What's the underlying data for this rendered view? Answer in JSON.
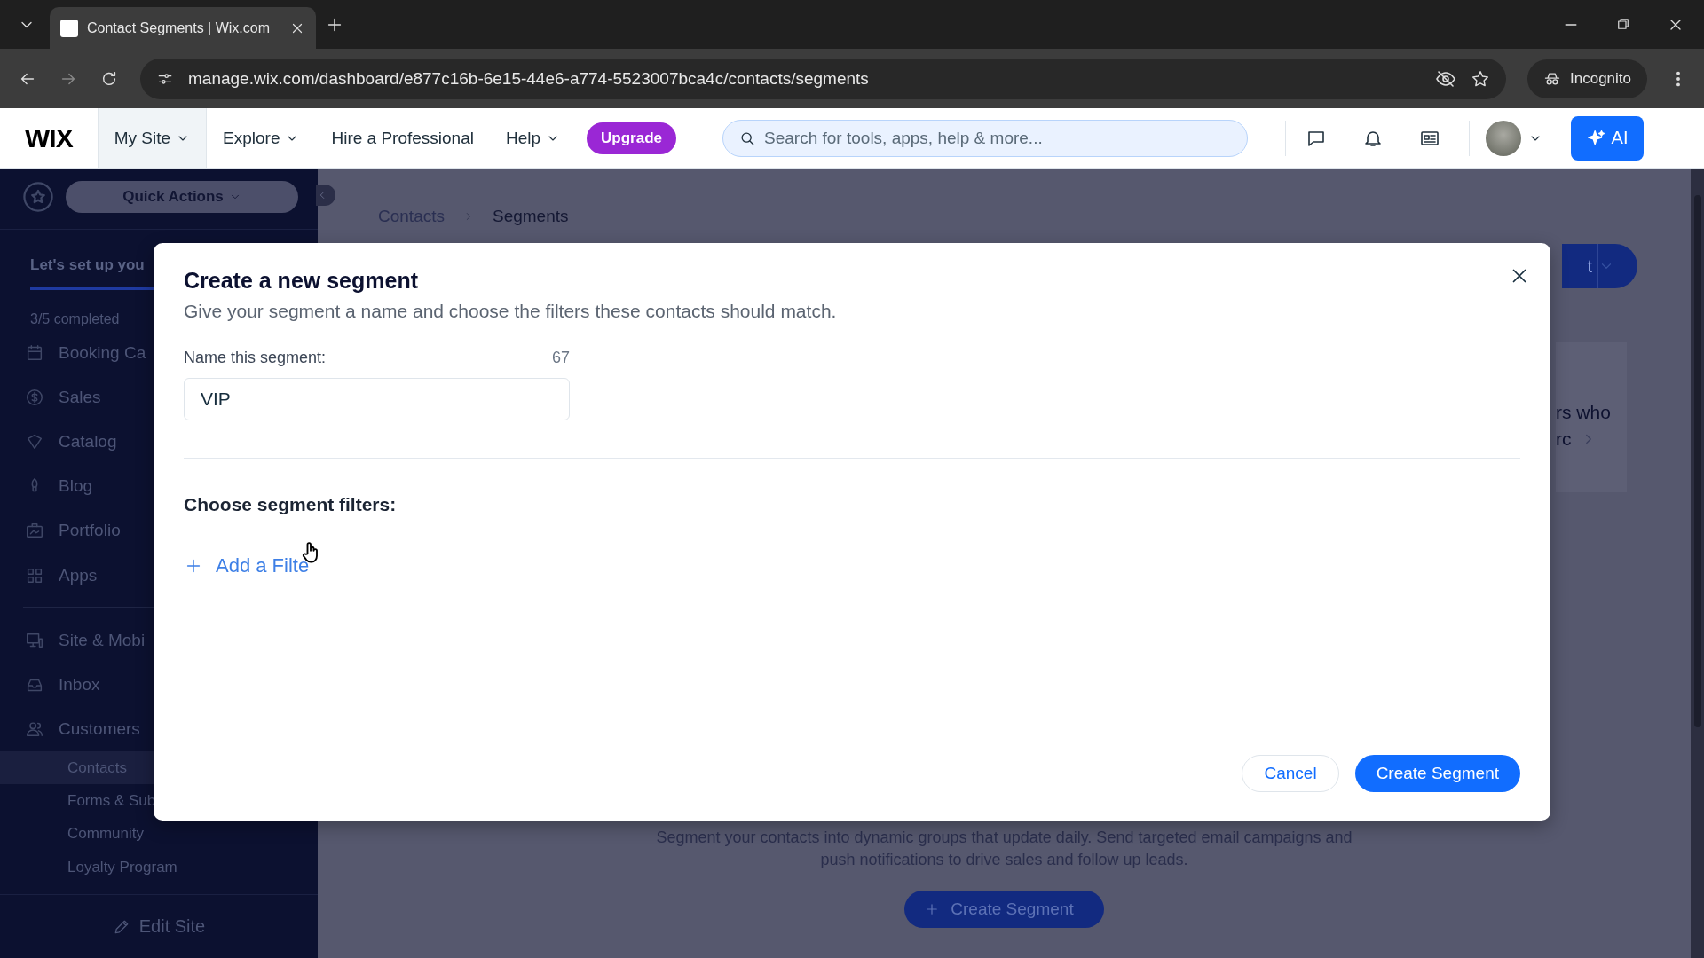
{
  "browser": {
    "tab_title": "Contact Segments | Wix.com",
    "url": "manage.wix.com/dashboard/e877c16b-6e15-44e6-a774-5523007bca4c/contacts/segments",
    "incognito_label": "Incognito"
  },
  "header": {
    "logo": "WIX",
    "nav": [
      {
        "label": "My Site",
        "has_menu": true,
        "selected": true
      },
      {
        "label": "Explore",
        "has_menu": true,
        "selected": false
      },
      {
        "label": "Hire a Professional",
        "has_menu": false,
        "selected": false
      },
      {
        "label": "Help",
        "has_menu": true,
        "selected": false
      }
    ],
    "upgrade": "Upgrade",
    "search": {
      "placeholder": "Search for tools, apps, help & more..."
    },
    "ai_label": "AI"
  },
  "sidebar": {
    "quick_actions": "Quick Actions",
    "setup_title": "Let's set up you",
    "progress": {
      "level": 1
    },
    "progress_text": "3/5 completed",
    "items": [
      {
        "kind": "item",
        "label": "Booking Ca",
        "selected": false
      },
      {
        "kind": "item",
        "label": "Sales",
        "selected": false
      },
      {
        "kind": "item",
        "label": "Catalog",
        "selected": false
      },
      {
        "kind": "item",
        "label": "Blog",
        "selected": false
      },
      {
        "kind": "item",
        "label": "Portfolio",
        "selected": false
      },
      {
        "kind": "item",
        "label": "Apps",
        "selected": false
      },
      {
        "kind": "divider"
      },
      {
        "kind": "item",
        "label": "Site & Mobi",
        "selected": false
      },
      {
        "kind": "item",
        "label": "Inbox",
        "selected": false
      },
      {
        "kind": "item",
        "label": "Customers",
        "selected": false
      },
      {
        "kind": "sub",
        "label": "Contacts",
        "selected": true
      },
      {
        "kind": "sub",
        "label": "Forms & Sub",
        "selected": false
      },
      {
        "kind": "sub",
        "label": "Community",
        "selected": false
      },
      {
        "kind": "sub",
        "label": "Loyalty Program",
        "selected": false
      }
    ],
    "edit_site": "Edit Site"
  },
  "main": {
    "breadcrumb": [
      "Contacts",
      "Segments"
    ],
    "top_button_fragment": "t",
    "card_fragment": [
      "rs who",
      "rc"
    ],
    "description": "Segment your contacts into dynamic groups that update daily. Send targeted email campaigns and push notifications to drive sales and follow up leads.",
    "create_button": "Create Segment"
  },
  "modal": {
    "title": "Create a new segment",
    "subtitle": "Give your segment a name and choose the filters these contacts should match.",
    "name_label": "Name this segment:",
    "char_count": "67",
    "name_value": "VIP",
    "filters_title": "Choose segment filters:",
    "add_filter": "Add a Filte",
    "cancel": "Cancel",
    "submit": "Create Segment"
  }
}
